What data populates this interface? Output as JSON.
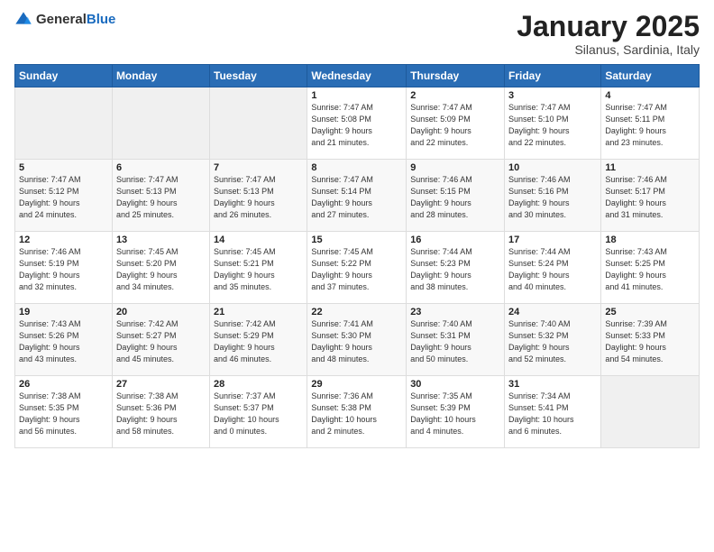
{
  "logo": {
    "general": "General",
    "blue": "Blue"
  },
  "header": {
    "month": "January 2025",
    "location": "Silanus, Sardinia, Italy"
  },
  "weekdays": [
    "Sunday",
    "Monday",
    "Tuesday",
    "Wednesday",
    "Thursday",
    "Friday",
    "Saturday"
  ],
  "weeks": [
    [
      {
        "day": "",
        "info": ""
      },
      {
        "day": "",
        "info": ""
      },
      {
        "day": "",
        "info": ""
      },
      {
        "day": "1",
        "info": "Sunrise: 7:47 AM\nSunset: 5:08 PM\nDaylight: 9 hours\nand 21 minutes."
      },
      {
        "day": "2",
        "info": "Sunrise: 7:47 AM\nSunset: 5:09 PM\nDaylight: 9 hours\nand 22 minutes."
      },
      {
        "day": "3",
        "info": "Sunrise: 7:47 AM\nSunset: 5:10 PM\nDaylight: 9 hours\nand 22 minutes."
      },
      {
        "day": "4",
        "info": "Sunrise: 7:47 AM\nSunset: 5:11 PM\nDaylight: 9 hours\nand 23 minutes."
      }
    ],
    [
      {
        "day": "5",
        "info": "Sunrise: 7:47 AM\nSunset: 5:12 PM\nDaylight: 9 hours\nand 24 minutes."
      },
      {
        "day": "6",
        "info": "Sunrise: 7:47 AM\nSunset: 5:13 PM\nDaylight: 9 hours\nand 25 minutes."
      },
      {
        "day": "7",
        "info": "Sunrise: 7:47 AM\nSunset: 5:13 PM\nDaylight: 9 hours\nand 26 minutes."
      },
      {
        "day": "8",
        "info": "Sunrise: 7:47 AM\nSunset: 5:14 PM\nDaylight: 9 hours\nand 27 minutes."
      },
      {
        "day": "9",
        "info": "Sunrise: 7:46 AM\nSunset: 5:15 PM\nDaylight: 9 hours\nand 28 minutes."
      },
      {
        "day": "10",
        "info": "Sunrise: 7:46 AM\nSunset: 5:16 PM\nDaylight: 9 hours\nand 30 minutes."
      },
      {
        "day": "11",
        "info": "Sunrise: 7:46 AM\nSunset: 5:17 PM\nDaylight: 9 hours\nand 31 minutes."
      }
    ],
    [
      {
        "day": "12",
        "info": "Sunrise: 7:46 AM\nSunset: 5:19 PM\nDaylight: 9 hours\nand 32 minutes."
      },
      {
        "day": "13",
        "info": "Sunrise: 7:45 AM\nSunset: 5:20 PM\nDaylight: 9 hours\nand 34 minutes."
      },
      {
        "day": "14",
        "info": "Sunrise: 7:45 AM\nSunset: 5:21 PM\nDaylight: 9 hours\nand 35 minutes."
      },
      {
        "day": "15",
        "info": "Sunrise: 7:45 AM\nSunset: 5:22 PM\nDaylight: 9 hours\nand 37 minutes."
      },
      {
        "day": "16",
        "info": "Sunrise: 7:44 AM\nSunset: 5:23 PM\nDaylight: 9 hours\nand 38 minutes."
      },
      {
        "day": "17",
        "info": "Sunrise: 7:44 AM\nSunset: 5:24 PM\nDaylight: 9 hours\nand 40 minutes."
      },
      {
        "day": "18",
        "info": "Sunrise: 7:43 AM\nSunset: 5:25 PM\nDaylight: 9 hours\nand 41 minutes."
      }
    ],
    [
      {
        "day": "19",
        "info": "Sunrise: 7:43 AM\nSunset: 5:26 PM\nDaylight: 9 hours\nand 43 minutes."
      },
      {
        "day": "20",
        "info": "Sunrise: 7:42 AM\nSunset: 5:27 PM\nDaylight: 9 hours\nand 45 minutes."
      },
      {
        "day": "21",
        "info": "Sunrise: 7:42 AM\nSunset: 5:29 PM\nDaylight: 9 hours\nand 46 minutes."
      },
      {
        "day": "22",
        "info": "Sunrise: 7:41 AM\nSunset: 5:30 PM\nDaylight: 9 hours\nand 48 minutes."
      },
      {
        "day": "23",
        "info": "Sunrise: 7:40 AM\nSunset: 5:31 PM\nDaylight: 9 hours\nand 50 minutes."
      },
      {
        "day": "24",
        "info": "Sunrise: 7:40 AM\nSunset: 5:32 PM\nDaylight: 9 hours\nand 52 minutes."
      },
      {
        "day": "25",
        "info": "Sunrise: 7:39 AM\nSunset: 5:33 PM\nDaylight: 9 hours\nand 54 minutes."
      }
    ],
    [
      {
        "day": "26",
        "info": "Sunrise: 7:38 AM\nSunset: 5:35 PM\nDaylight: 9 hours\nand 56 minutes."
      },
      {
        "day": "27",
        "info": "Sunrise: 7:38 AM\nSunset: 5:36 PM\nDaylight: 9 hours\nand 58 minutes."
      },
      {
        "day": "28",
        "info": "Sunrise: 7:37 AM\nSunset: 5:37 PM\nDaylight: 10 hours\nand 0 minutes."
      },
      {
        "day": "29",
        "info": "Sunrise: 7:36 AM\nSunset: 5:38 PM\nDaylight: 10 hours\nand 2 minutes."
      },
      {
        "day": "30",
        "info": "Sunrise: 7:35 AM\nSunset: 5:39 PM\nDaylight: 10 hours\nand 4 minutes."
      },
      {
        "day": "31",
        "info": "Sunrise: 7:34 AM\nSunset: 5:41 PM\nDaylight: 10 hours\nand 6 minutes."
      },
      {
        "day": "",
        "info": ""
      }
    ]
  ]
}
